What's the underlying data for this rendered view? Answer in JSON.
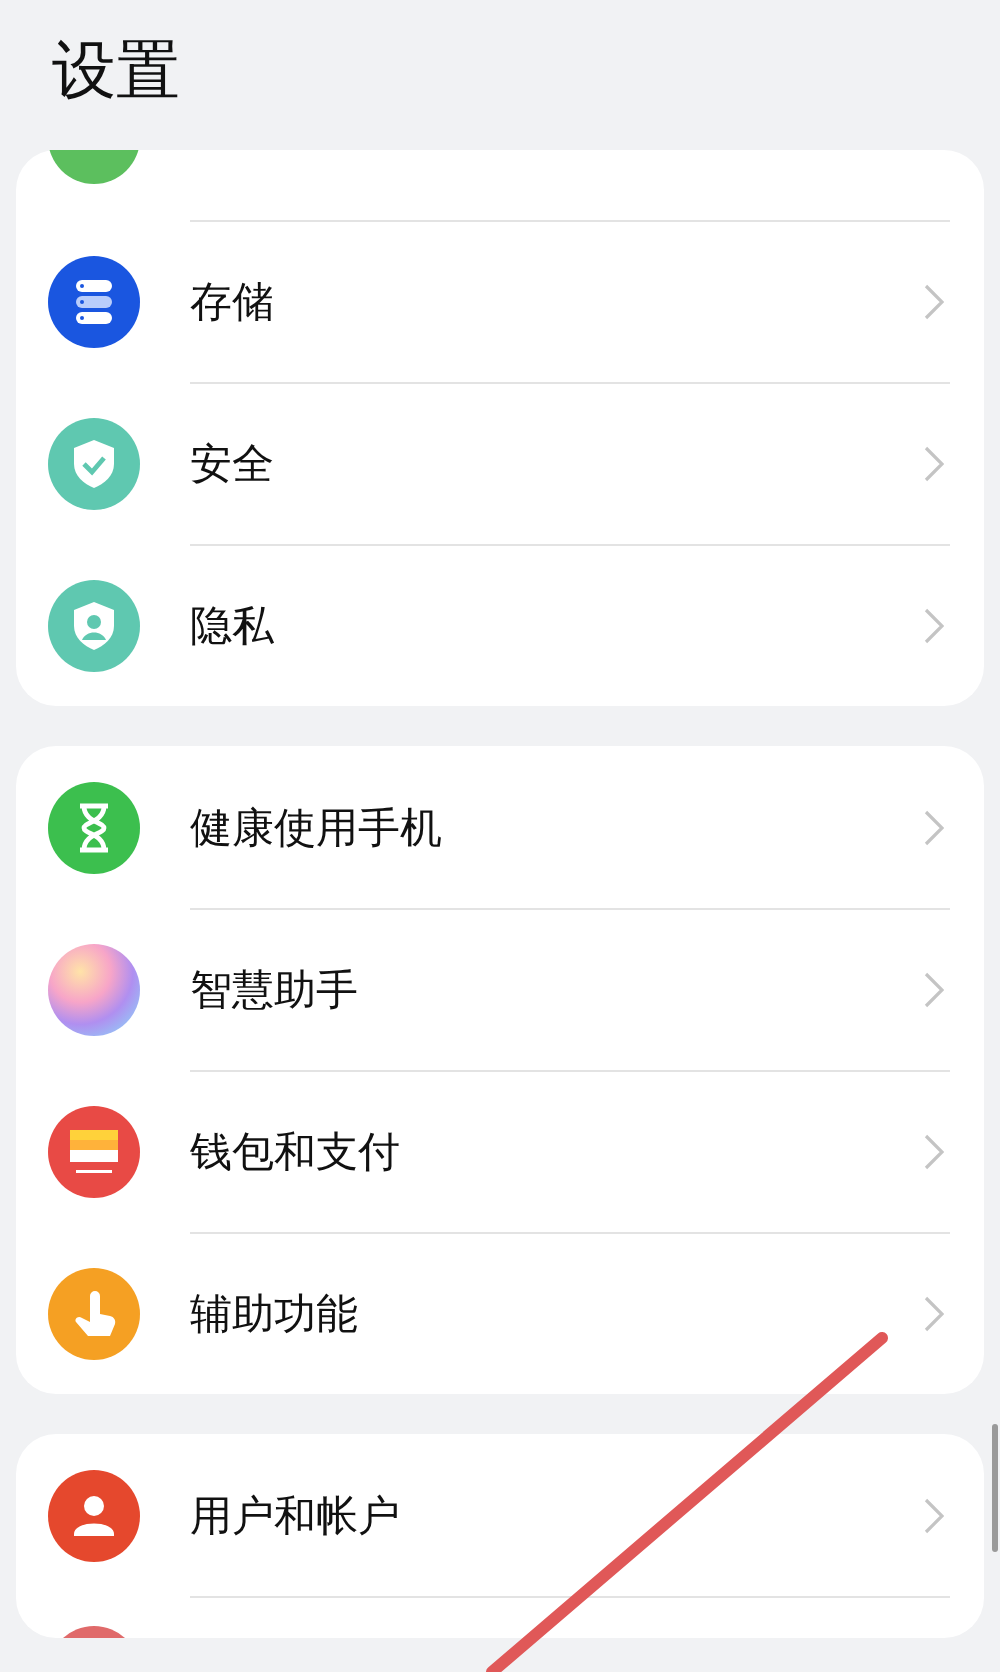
{
  "title": "设置",
  "groups": [
    {
      "items": [
        {
          "kind": "partial-top",
          "color": "#5cbf5e"
        },
        {
          "kind": "row",
          "color": "#1a56e0",
          "label": "存储"
        },
        {
          "kind": "row",
          "color": "#5fc8b0",
          "label": "安全"
        },
        {
          "kind": "row",
          "color": "#5fc8b0",
          "label": "隐私"
        }
      ]
    },
    {
      "items": [
        {
          "kind": "row",
          "color": "#3cbf4e",
          "label": "健康使用手机"
        },
        {
          "kind": "row",
          "color": "#b08ff0",
          "label": "智慧助手"
        },
        {
          "kind": "row",
          "color": "#e84a45",
          "label": "钱包和支付"
        },
        {
          "kind": "row",
          "color": "#f5a023",
          "label": "辅助功能"
        }
      ]
    },
    {
      "items": [
        {
          "kind": "row",
          "color": "#e5482d",
          "label": "用户和帐户"
        },
        {
          "kind": "partial-bottom",
          "color": "#e06a6a"
        }
      ]
    }
  ]
}
